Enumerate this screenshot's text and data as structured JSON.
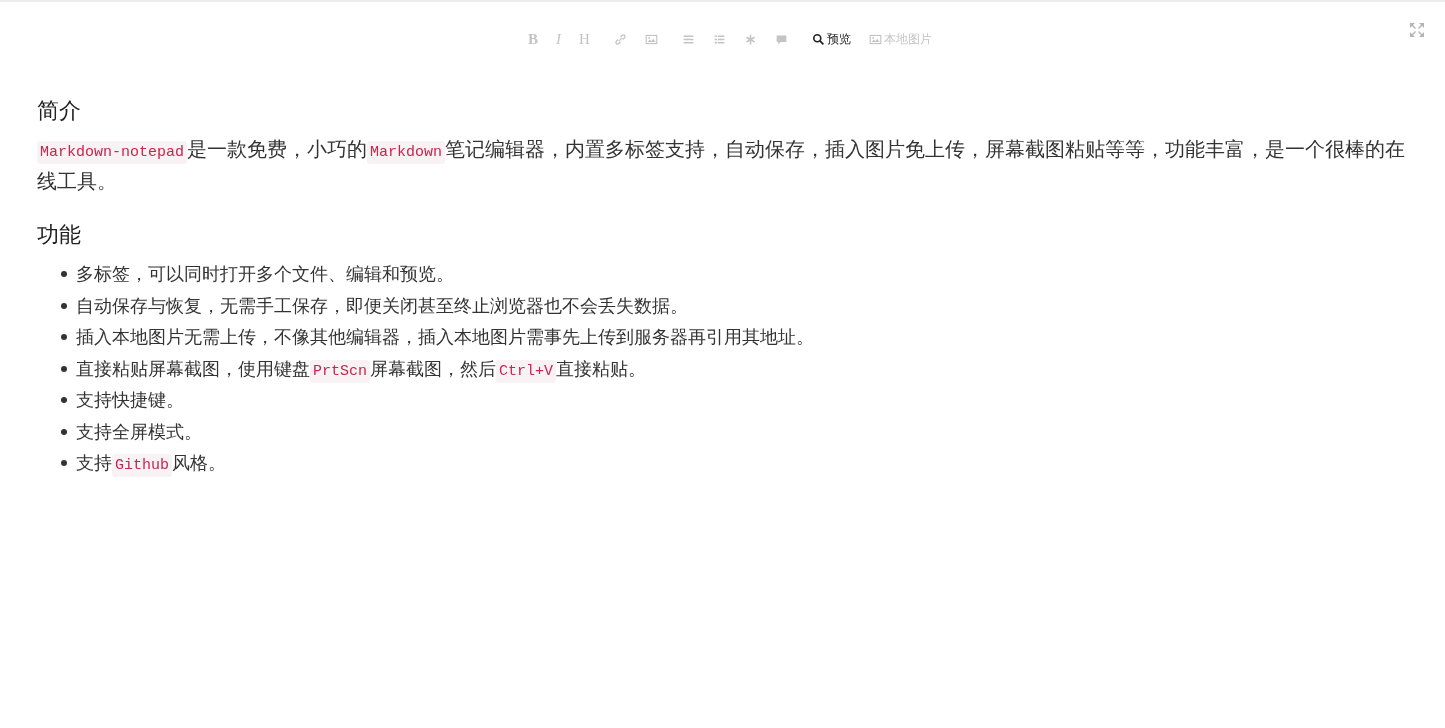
{
  "toolbar": [
    {
      "kind": "bold",
      "glyph": "B",
      "disabled": true
    },
    {
      "kind": "italic",
      "glyph": "I",
      "disabled": true
    },
    {
      "kind": "heading",
      "glyph": "H",
      "disabled": true
    },
    {
      "kind": "link",
      "disabled": true
    },
    {
      "kind": "image",
      "disabled": true
    },
    {
      "kind": "numbered",
      "disabled": true
    },
    {
      "kind": "bulleted",
      "disabled": true
    },
    {
      "kind": "asterisk",
      "disabled": true
    },
    {
      "kind": "comment",
      "disabled": true
    },
    {
      "kind": "preview",
      "label": "预览",
      "disabled": false
    },
    {
      "kind": "picture",
      "label": "本地图片",
      "disabled": true
    }
  ],
  "document": [
    {
      "kind": "heading",
      "text": "简介"
    },
    {
      "kind": "paragraph",
      "segments": [
        {
          "kind": "code",
          "text": "Markdown-notepad"
        },
        {
          "kind": "text",
          "text": "是一款免费，小巧的"
        },
        {
          "kind": "code",
          "text": "Markdown"
        },
        {
          "kind": "text",
          "text": "笔记编辑器，内置多标签支持，自动保存，插入图片免上传，屏幕截图粘贴等等，功能丰富，是一个很棒的在线工具。"
        }
      ]
    },
    {
      "kind": "heading",
      "text": "功能"
    },
    {
      "kind": "list",
      "items": [
        [
          {
            "kind": "text",
            "text": "多标签，可以同时打开多个文件、编辑和预览。"
          }
        ],
        [
          {
            "kind": "text",
            "text": "自动保存与恢复，无需手工保存，即便关闭甚至终止浏览器也不会丢失数据。"
          }
        ],
        [
          {
            "kind": "text",
            "text": "插入本地图片无需上传，不像其他编辑器，插入本地图片需事先上传到服务器再引用其地址。"
          }
        ],
        [
          {
            "kind": "text",
            "text": "直接粘贴屏幕截图，使用键盘"
          },
          {
            "kind": "code",
            "text": "PrtScn"
          },
          {
            "kind": "text",
            "text": "屏幕截图，然后"
          },
          {
            "kind": "code",
            "text": "Ctrl+V"
          },
          {
            "kind": "text",
            "text": "直接粘贴。"
          }
        ],
        [
          {
            "kind": "text",
            "text": "支持快捷键。"
          }
        ],
        [
          {
            "kind": "text",
            "text": "支持全屏模式。"
          }
        ],
        [
          {
            "kind": "text",
            "text": "支持"
          },
          {
            "kind": "code",
            "text": "Github"
          },
          {
            "kind": "text",
            "text": "风格。"
          }
        ]
      ]
    }
  ]
}
